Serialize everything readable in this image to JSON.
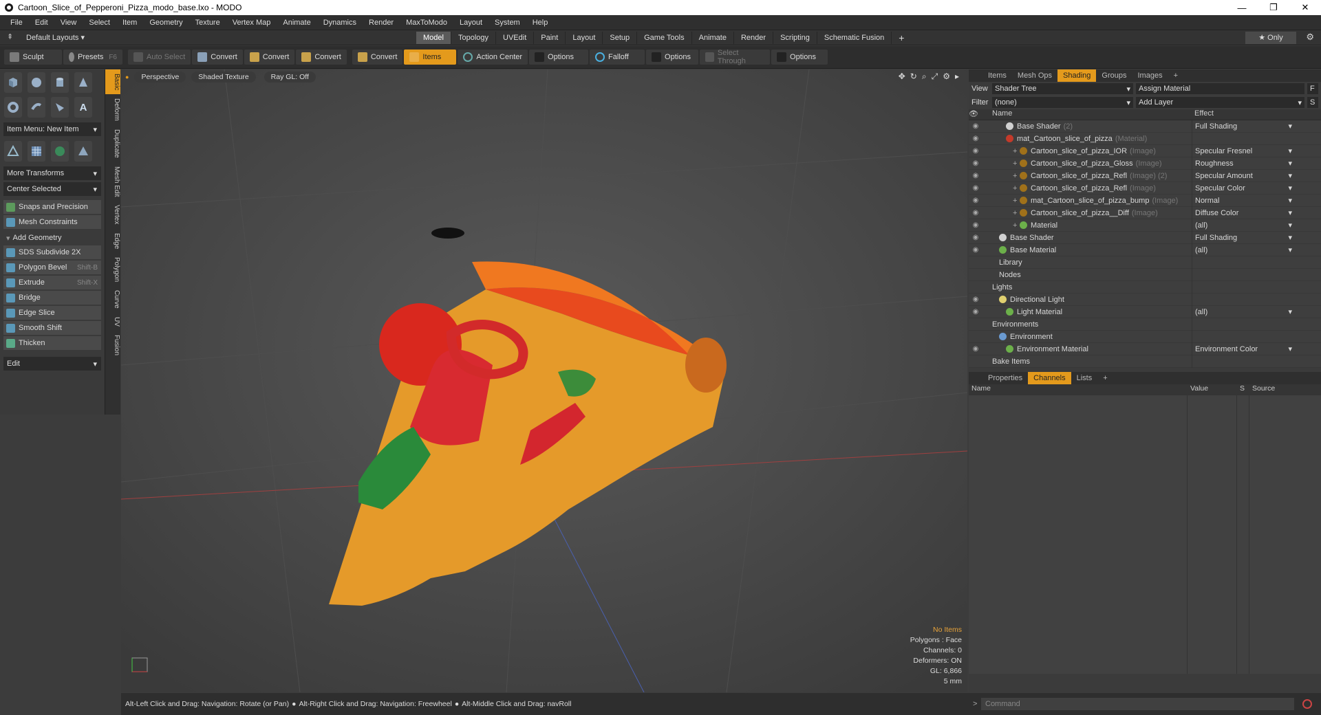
{
  "window": {
    "title": "Cartoon_Slice_of_Pepperoni_Pizza_modo_base.lxo - MODO",
    "minimize": "—",
    "maximize": "❐",
    "close": "✕"
  },
  "menu": [
    "File",
    "Edit",
    "View",
    "Select",
    "Item",
    "Geometry",
    "Texture",
    "Vertex Map",
    "Animate",
    "Dynamics",
    "Render",
    "MaxToModo",
    "Layout",
    "System",
    "Help"
  ],
  "layout_bar": {
    "default_layouts": "Default Layouts ▾",
    "tabs": [
      "Model",
      "Topology",
      "UVEdit",
      "Paint",
      "Layout",
      "Setup",
      "Game Tools",
      "Animate",
      "Render",
      "Scripting",
      "Schematic Fusion"
    ],
    "active_tab": "Model",
    "add": "+",
    "only": "★ Only"
  },
  "toolbar": {
    "sculpt": "Sculpt",
    "presets": "Presets",
    "presets_key": "F6",
    "auto_select": "Auto Select",
    "convert1": "Convert",
    "convert2": "Convert",
    "convert3": "Convert",
    "convert4": "Convert",
    "items": "Items",
    "action_center": "Action Center",
    "options1": "Options",
    "falloff": "Falloff",
    "options2": "Options",
    "select_through": "Select Through",
    "options3": "Options"
  },
  "left_panel": {
    "item_menu": "Item Menu: New Item",
    "more_transforms": "More Transforms",
    "center_selected": "Center Selected",
    "snaps": "Snaps and Precision",
    "mesh_constraints": "Mesh Constraints",
    "add_geometry": "Add Geometry",
    "tools": [
      {
        "label": "SDS Subdivide 2X",
        "shortcut": ""
      },
      {
        "label": "Polygon Bevel",
        "shortcut": "Shift-B"
      },
      {
        "label": "Extrude",
        "shortcut": "Shift-X"
      },
      {
        "label": "Bridge",
        "shortcut": ""
      },
      {
        "label": "Edge Slice",
        "shortcut": ""
      },
      {
        "label": "Smooth Shift",
        "shortcut": ""
      },
      {
        "label": "Thicken",
        "shortcut": ""
      }
    ],
    "edit": "Edit",
    "vertical_tabs": [
      "Basic",
      "Deform",
      "Duplicate",
      "Mesh Edit",
      "Vertex",
      "Edge",
      "Polygon",
      "Curve",
      "UV",
      "Fusion"
    ]
  },
  "viewport": {
    "view": "Perspective",
    "shading": "Shaded Texture",
    "raygl": "Ray GL: Off",
    "info": {
      "no_items": "No Items",
      "polygons": "Polygons : Face",
      "channels": "Channels: 0",
      "deformers": "Deformers: ON",
      "gl": "GL: 6,866",
      "scale": "5 mm"
    }
  },
  "shading_panel": {
    "tabs": [
      "Items",
      "Mesh Ops",
      "Shading",
      "Groups",
      "Images",
      "+"
    ],
    "active_tab": "Shading",
    "view_label": "View",
    "view_value": "Shader Tree",
    "assign_material": "Assign Material",
    "f_btn": "F",
    "filter_label": "Filter",
    "filter_value": "(none)",
    "add_layer": "Add Layer",
    "s_btn": "S",
    "col_name": "Name",
    "col_effect": "Effect",
    "rows": [
      {
        "indent": 3,
        "name": "Base Shader",
        "tag": "(2)",
        "effect": "Full Shading",
        "ball": "#d0d0d0",
        "eye": true,
        "drop": true
      },
      {
        "indent": 3,
        "name": "mat_Cartoon_slice_of_pizza",
        "tag": "(Material)",
        "effect": "",
        "ball": "#c43a2a",
        "eye": true,
        "drop": false
      },
      {
        "indent": 4,
        "name": "Cartoon_slice_of_pizza_IOR",
        "tag": "(Image)",
        "effect": "Specular Fresnel",
        "ball": "#a0711a",
        "eye": true,
        "drop": true
      },
      {
        "indent": 4,
        "name": "Cartoon_slice_of_pizza_Gloss",
        "tag": "(Image)",
        "effect": "Roughness",
        "ball": "#a0711a",
        "eye": true,
        "drop": true
      },
      {
        "indent": 4,
        "name": "Cartoon_slice_of_pizza_Refl",
        "tag": "(Image) (2)",
        "effect": "Specular Amount",
        "ball": "#a0711a",
        "eye": true,
        "drop": true
      },
      {
        "indent": 4,
        "name": "Cartoon_slice_of_pizza_Refl",
        "tag": "(Image)",
        "effect": "Specular Color",
        "ball": "#a0711a",
        "eye": true,
        "drop": true
      },
      {
        "indent": 4,
        "name": "mat_Cartoon_slice_of_pizza_bump",
        "tag": "(Image)",
        "effect": "Normal",
        "ball": "#a0711a",
        "eye": true,
        "drop": true
      },
      {
        "indent": 4,
        "name": "Cartoon_slice_of_pizza__Diff",
        "tag": "(Image)",
        "effect": "Diffuse Color",
        "ball": "#a0711a",
        "eye": true,
        "drop": true
      },
      {
        "indent": 4,
        "name": "Material",
        "tag": "",
        "effect": "(all)",
        "ball": "#6cb04a",
        "eye": true,
        "drop": true
      },
      {
        "indent": 2,
        "name": "Base Shader",
        "tag": "",
        "effect": "Full Shading",
        "ball": "#d0d0d0",
        "eye": true,
        "drop": true
      },
      {
        "indent": 2,
        "name": "Base Material",
        "tag": "",
        "effect": "(all)",
        "ball": "#6cb04a",
        "eye": true,
        "drop": true
      },
      {
        "indent": 2,
        "name": "Library",
        "tag": "",
        "effect": "",
        "ball": "",
        "eye": false,
        "drop": false
      },
      {
        "indent": 2,
        "name": "Nodes",
        "tag": "",
        "effect": "",
        "ball": "",
        "eye": false,
        "drop": false
      },
      {
        "indent": 1,
        "name": "Lights",
        "tag": "",
        "effect": "",
        "ball": "",
        "eye": false,
        "drop": false
      },
      {
        "indent": 2,
        "name": "Directional Light",
        "tag": "",
        "effect": "",
        "ball": "#e0d070",
        "eye": true,
        "drop": false
      },
      {
        "indent": 3,
        "name": "Light Material",
        "tag": "",
        "effect": "(all)",
        "ball": "#6cb04a",
        "eye": true,
        "drop": true
      },
      {
        "indent": 1,
        "name": "Environments",
        "tag": "",
        "effect": "",
        "ball": "",
        "eye": false,
        "drop": false
      },
      {
        "indent": 2,
        "name": "Environment",
        "tag": "",
        "effect": "",
        "ball": "#6a9ad0",
        "eye": false,
        "drop": false
      },
      {
        "indent": 3,
        "name": "Environment Material",
        "tag": "",
        "effect": "Environment Color",
        "ball": "#6cb04a",
        "eye": true,
        "drop": true
      },
      {
        "indent": 1,
        "name": "Bake Items",
        "tag": "",
        "effect": "",
        "ball": "",
        "eye": false,
        "drop": false
      }
    ]
  },
  "properties_panel": {
    "tabs": [
      "Properties",
      "Channels",
      "Lists",
      "+"
    ],
    "active_tab": "Channels",
    "columns": [
      "Name",
      "Value",
      "S",
      "Source"
    ]
  },
  "status": {
    "hint1": "Alt-Left Click and Drag: Navigation: Rotate (or Pan)",
    "hint2": "Alt-Right Click and Drag: Navigation: Freewheel",
    "hint3": "Alt-Middle Click and Drag: navRoll"
  },
  "command": {
    "placeholder": "Command"
  },
  "colors": {
    "accent": "#e49a1c"
  }
}
